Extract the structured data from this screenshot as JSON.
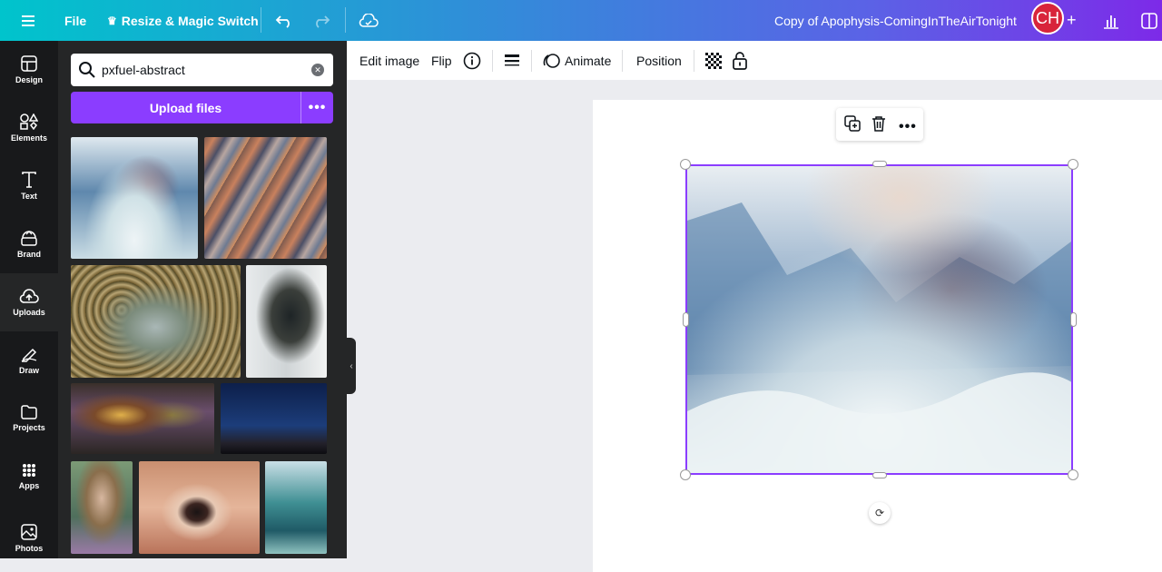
{
  "topbar": {
    "menu_icon": "hamburger-icon",
    "file_label": "File",
    "resize_label": "Resize & Magic Switch",
    "resize_icon": "sparkle-crown-icon",
    "undo_icon": "undo-icon",
    "redo_icon": "redo-icon",
    "cloud_icon": "cloud-saved-icon",
    "doc_title": "Copy of Apophysis-ComingInTheAirTonight",
    "avatar_initials": "CH",
    "add_icon": "plus-icon",
    "insights_icon": "bar-chart-icon",
    "share_icon": "panel-icon"
  },
  "rail": {
    "items": [
      {
        "label": "Design",
        "icon": "layout-icon"
      },
      {
        "label": "Elements",
        "icon": "shapes-icon"
      },
      {
        "label": "Text",
        "icon": "text-icon"
      },
      {
        "label": "Brand",
        "icon": "brand-crown-icon"
      },
      {
        "label": "Uploads",
        "icon": "cloud-upload-icon"
      },
      {
        "label": "Draw",
        "icon": "pen-icon"
      },
      {
        "label": "Projects",
        "icon": "folder-icon"
      },
      {
        "label": "Apps",
        "icon": "grid-icon"
      },
      {
        "label": "Photos",
        "icon": "photo-icon"
      }
    ],
    "active": "Uploads"
  },
  "panel": {
    "search_value": "pxfuel-abstract",
    "upload_label": "Upload files",
    "more_label": "•••"
  },
  "context_bar": {
    "edit_image": "Edit image",
    "flip": "Flip",
    "info_icon": "info-icon",
    "border_icon": "border-style-icon",
    "animate": "Animate",
    "position": "Position",
    "transparency_icon": "transparency-icon",
    "lock_icon": "lock-icon"
  },
  "floating_toolbar": {
    "duplicate_icon": "duplicate-icon",
    "delete_icon": "trash-icon",
    "more_icon": "more-icon"
  },
  "colors": {
    "accent": "#8b3dff",
    "topbar_start": "#00c4cc",
    "topbar_end": "#7d2ae8",
    "avatar": "#d8243b"
  }
}
